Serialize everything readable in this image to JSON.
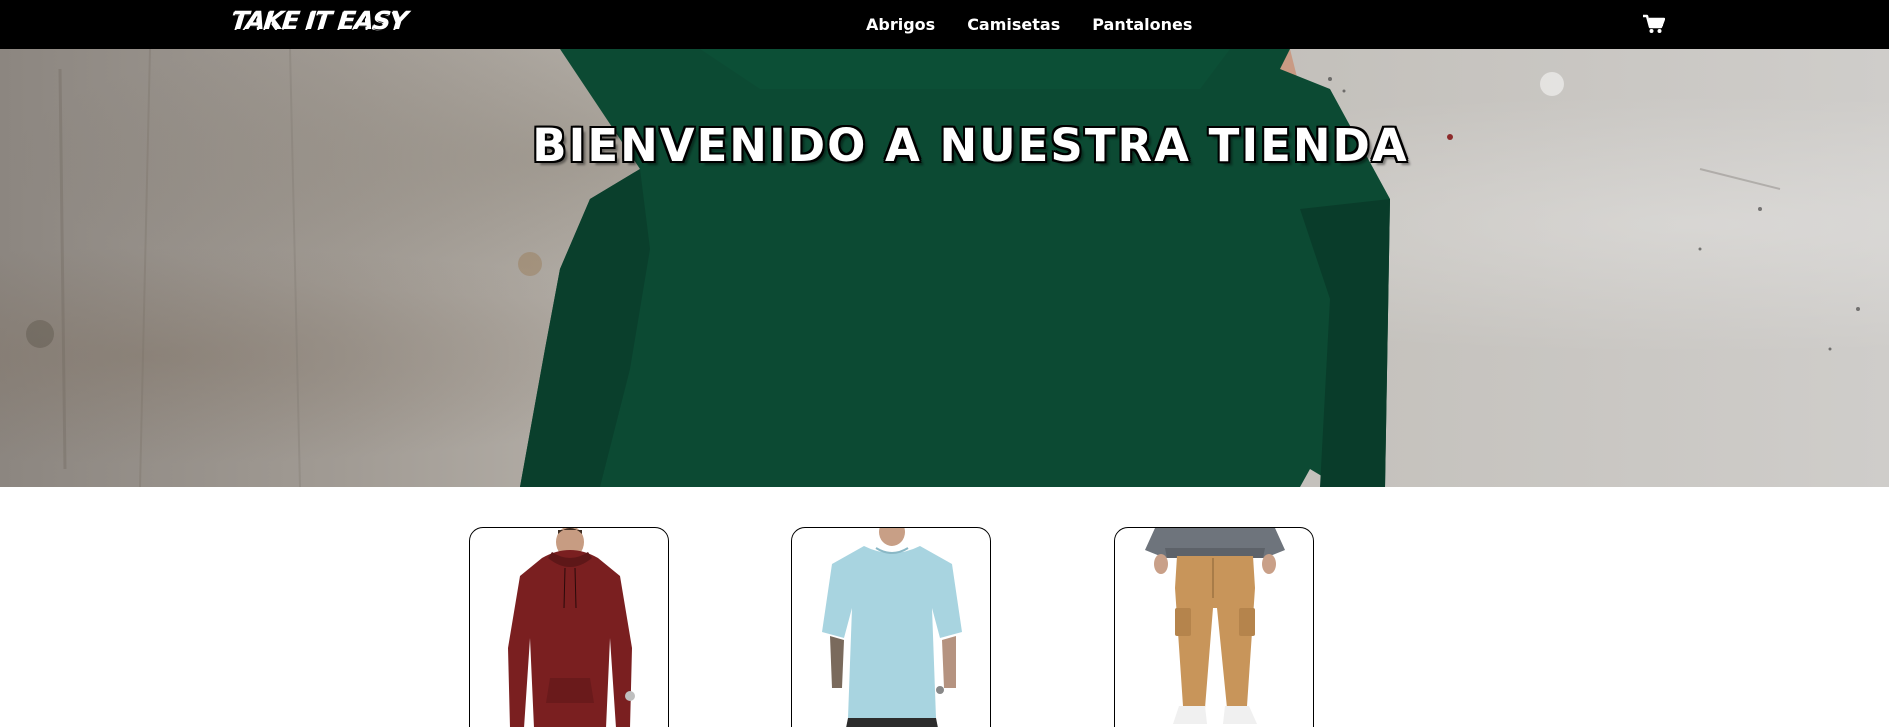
{
  "brand": {
    "logo_text": "TAKE IT EASY"
  },
  "nav": {
    "items": [
      {
        "label": "Abrigos"
      },
      {
        "label": "Camisetas"
      },
      {
        "label": "Pantalones"
      }
    ],
    "cart_icon": "cart-icon"
  },
  "hero": {
    "title": "BIENVENIDO A NUESTRA TIENDA",
    "image": "man-in-green-sweatshirt-photo"
  },
  "products": [
    {
      "image": "burgundy-hoodie-photo"
    },
    {
      "image": "light-blue-tshirt-photo"
    },
    {
      "image": "khaki-cargo-pants-photo"
    }
  ],
  "colors": {
    "navbar": "#000000",
    "sweater_green": "#0c4a33",
    "hoodie": "#7a1f20",
    "tshirt": "#a8d4e0",
    "pants": "#c8955a"
  }
}
